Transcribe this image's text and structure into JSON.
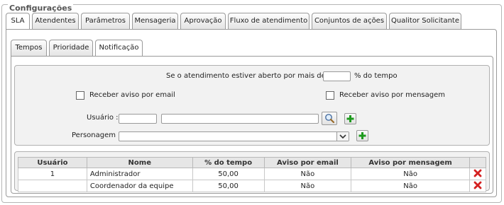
{
  "legend": "Configurações",
  "tabs": [
    "SLA",
    "Atendentes",
    "Parâmetros",
    "Mensageria",
    "Aprovação",
    "Fluxo de atendimento",
    "Conjuntos de ações",
    "Qualitor Solicitante"
  ],
  "subtabs": [
    "Tempos",
    "Prioridade",
    "Notificação"
  ],
  "form": {
    "threshold_prefix": "Se o atendimento estiver aberto por mais de",
    "threshold_required": "*",
    "threshold_colon": ":",
    "threshold_value": "",
    "threshold_suffix": "% do tempo",
    "email_label": "Receber aviso por email",
    "message_label": "Receber aviso por mensagem",
    "user_label": "Usuário :",
    "user_code": "",
    "user_name": "",
    "persona_label": "Personagem :",
    "persona_selected": ""
  },
  "table": {
    "headers": [
      "Usuário",
      "Nome",
      "% do tempo",
      "Aviso por email",
      "Aviso por mensagem",
      ""
    ],
    "rows": [
      {
        "usuario": "1",
        "nome": "Administrador",
        "tempo": "50,00",
        "email": "Não",
        "mensagem": "Não"
      },
      {
        "usuario": "",
        "nome": "Coordenador da equipe",
        "tempo": "50,00",
        "email": "Não",
        "mensagem": "Não"
      }
    ]
  },
  "colors": {
    "required": "#d40000",
    "delete": "#d42020",
    "add": "#1e9a1e"
  }
}
